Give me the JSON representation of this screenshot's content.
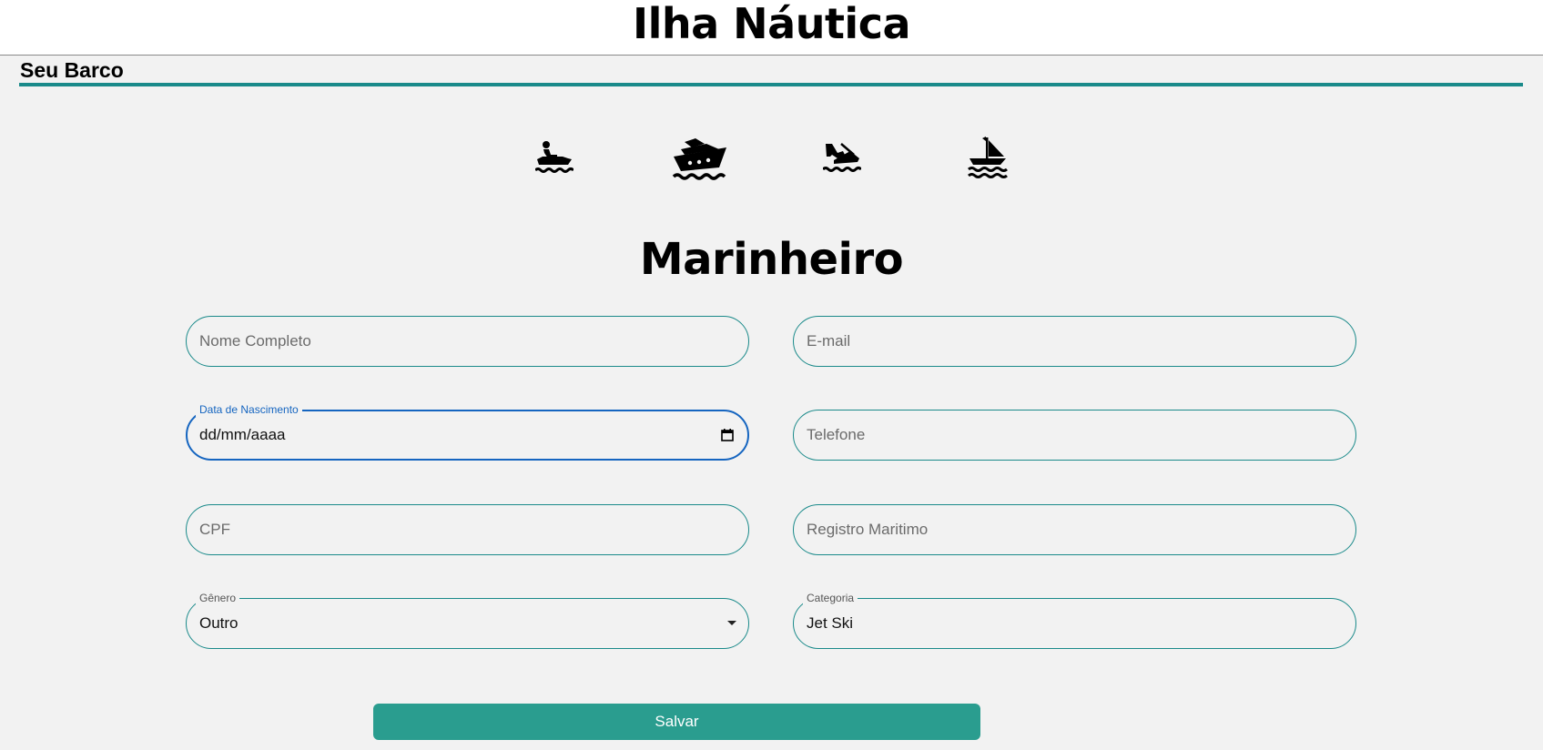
{
  "header": {
    "app_title": "Ilha Náutica",
    "section_title": "Seu Barco"
  },
  "category_icons": [
    {
      "icon": "jet-ski-icon"
    },
    {
      "icon": "yacht-icon"
    },
    {
      "icon": "water-ski-icon"
    },
    {
      "icon": "sailboat-icon"
    }
  ],
  "form": {
    "heading": "Marinheiro",
    "fields": {
      "nome": {
        "placeholder": "Nome Completo"
      },
      "email": {
        "placeholder": "E-mail"
      },
      "nascimento": {
        "label": "Data de Nascimento",
        "value": "dd/mm/aaaa"
      },
      "telefone": {
        "placeholder": "Telefone"
      },
      "cpf": {
        "placeholder": "CPF"
      },
      "registro": {
        "placeholder": "Registro Maritimo"
      },
      "genero": {
        "label": "Gênero",
        "value": "Outro"
      },
      "categoria": {
        "label": "Categoria",
        "value": "Jet Ski"
      }
    },
    "save_label": "Salvar"
  },
  "colors": {
    "accent": "#1a8a8a",
    "focus": "#1565c0",
    "button": "#2a9d8f",
    "background": "#f2f2f2"
  }
}
